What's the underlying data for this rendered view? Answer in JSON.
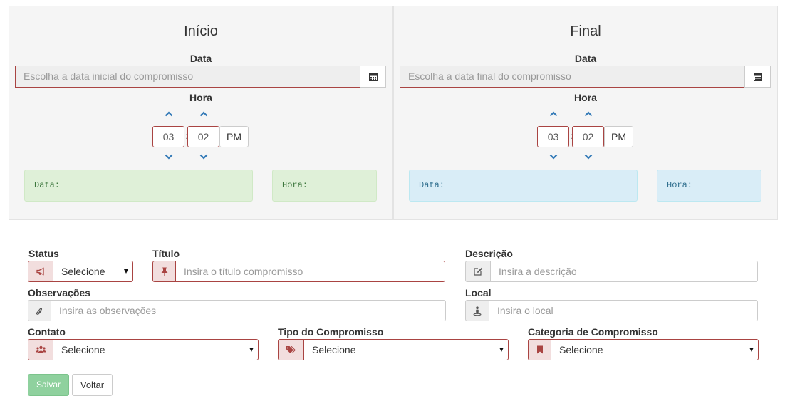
{
  "start": {
    "title": "Início",
    "date_label": "Data",
    "date_placeholder": "Escolha a data inicial do compromisso",
    "time_label": "Hora",
    "hour": "03",
    "separator": ":",
    "minute": "02",
    "meridian": "PM",
    "output_date_label": "Data:",
    "output_time_label": "Hora:",
    "output_color": "#dff0d8"
  },
  "end": {
    "title": "Final",
    "date_label": "Data",
    "date_placeholder": "Escolha a data final do compromisso",
    "time_label": "Hora",
    "hour": "03",
    "separator": ":",
    "minute": "02",
    "meridian": "PM",
    "output_date_label": "Data:",
    "output_time_label": "Hora:",
    "output_color": "#d9edf7"
  },
  "form": {
    "status": {
      "label": "Status",
      "value": "Selecione",
      "icon": "bullhorn-icon"
    },
    "titulo": {
      "label": "Título",
      "placeholder": "Insira o título compromisso",
      "icon": "pushpin-icon"
    },
    "descricao": {
      "label": "Descrição",
      "placeholder": "Insira a descrição",
      "icon": "edit-icon"
    },
    "observacoes": {
      "label": "Observações",
      "placeholder": "Insira as observações",
      "icon": "paperclip-icon"
    },
    "local": {
      "label": "Local",
      "placeholder": "Insira o local",
      "icon": "map-pin-person-icon"
    },
    "contato": {
      "label": "Contato",
      "value": "Selecione",
      "icon": "users-icon"
    },
    "tipo": {
      "label": "Tipo do Compromisso",
      "value": "Selecione",
      "icon": "tags-icon"
    },
    "categoria": {
      "label": "Categoria de Compromisso",
      "value": "Selecione",
      "icon": "bookmark-icon"
    }
  },
  "actions": {
    "save_label": "Salvar",
    "back_label": "Voltar"
  },
  "colors": {
    "error_border": "#a94442",
    "error_bg": "#f2dede",
    "save_button": "#8fd19e",
    "chevron": "#337ab7"
  }
}
